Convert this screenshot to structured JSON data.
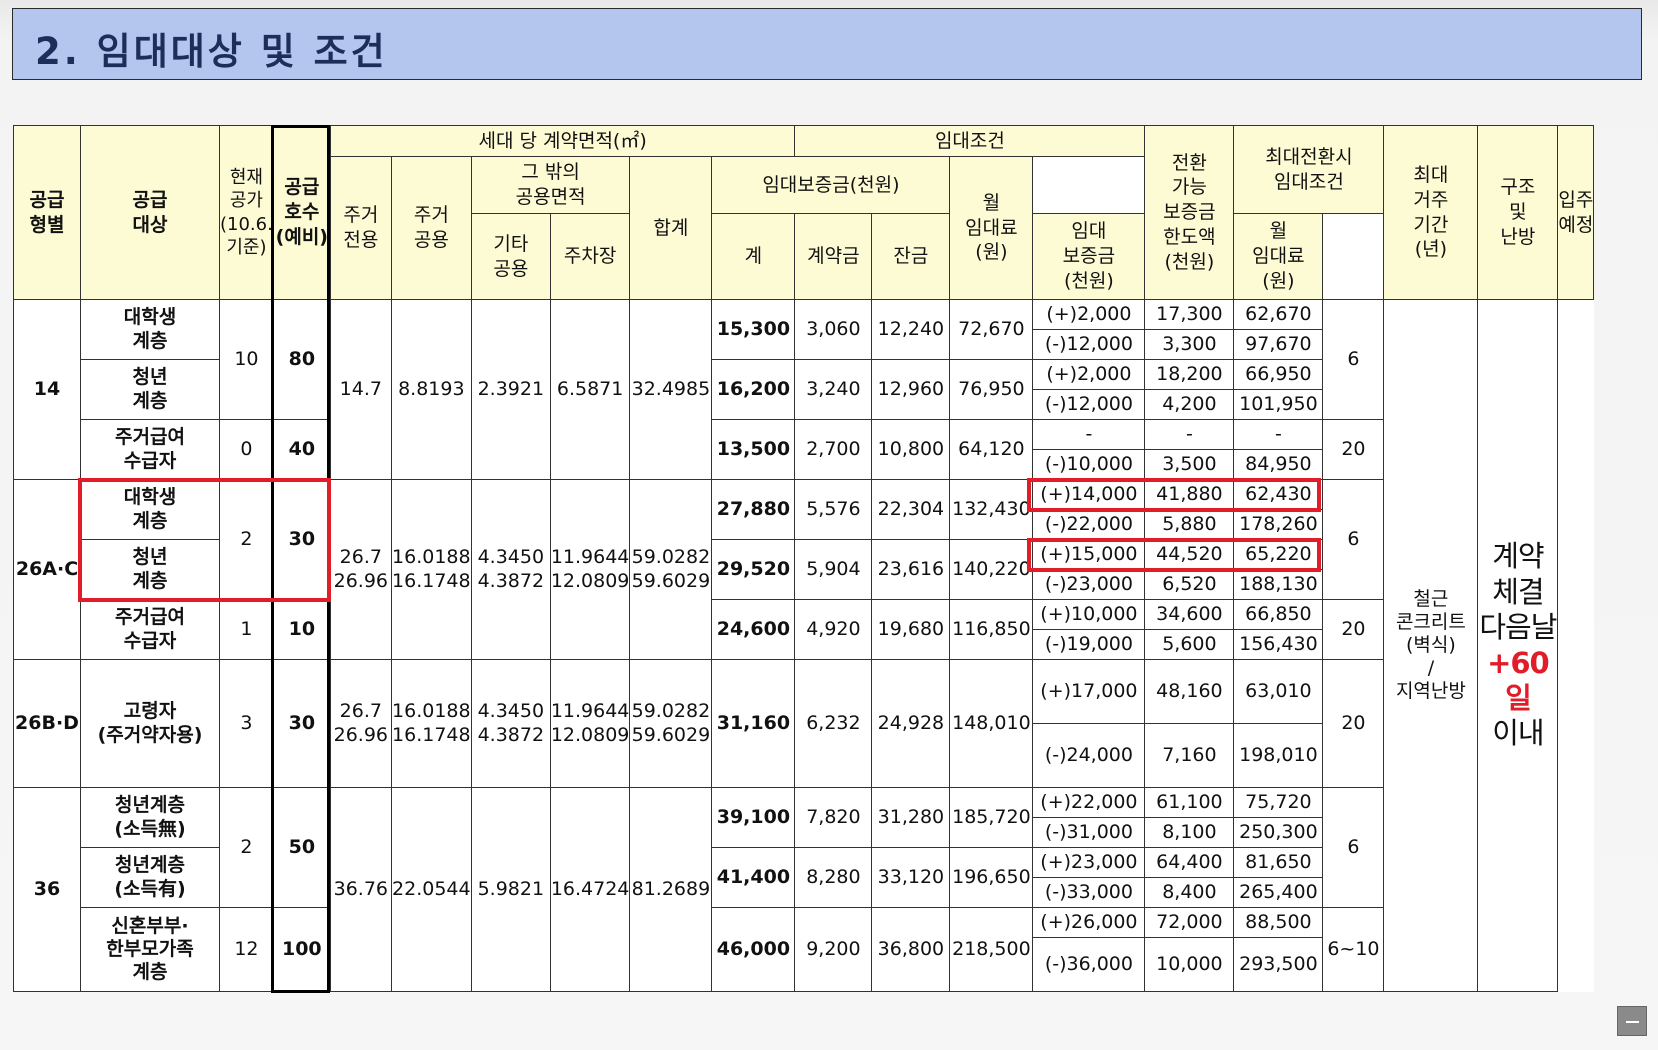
{
  "title": "2. 임대대상 및 조건",
  "header": {
    "supply_type": "공급\n형별",
    "supply_target": "공급\n대상",
    "vacancy": "현재\n공가\n(10.6.\n기준)",
    "supply_units": "공급\n호수\n(예비)",
    "area_group": "세대 당 계약면적(㎡)",
    "private_use": "주거\n전용",
    "residential_common": "주거\n공용",
    "other_common_group": "그 밖의\n공용면적",
    "other_common": "기타\n공용",
    "parking": "주차장",
    "area_total": "합계",
    "rent_group": "임대조건",
    "deposit_group": "임대보증금(천원)",
    "deposit_total": "계",
    "deposit_contract": "계약금",
    "deposit_balance": "잔금",
    "monthly_rent": "월\n임대료\n(원)",
    "convertible_limit": "전환\n가능\n보증금\n한도액\n(천원)",
    "max_conversion_group": "최대전환시\n임대조건",
    "conv_deposit": "임대\n보증금\n(천원)",
    "conv_rent": "월\n임대료\n(원)",
    "max_residence": "최대\n거주\n기간\n(년)",
    "structure": "구조\n및\n난방",
    "move_in": "입주\n예정"
  },
  "rows": {
    "t14": {
      "type": "14",
      "area": {
        "private": "14.7",
        "common": "8.8193",
        "other": "2.3921",
        "parking": "6.5871",
        "total": "32.4985"
      },
      "targets": {
        "a": {
          "name": "대학생\n계층",
          "deposit": "15,300",
          "contract": "3,060",
          "balance": "12,240",
          "rent": "72,670",
          "conv": [
            {
              "limit": "(+)2,000",
              "deposit": "17,300",
              "rent": "62,670"
            },
            {
              "limit": "(-)12,000",
              "deposit": "3,300",
              "rent": "97,670"
            }
          ]
        },
        "b": {
          "name": "청년\n계층",
          "deposit": "16,200",
          "contract": "3,240",
          "balance": "12,960",
          "rent": "76,950",
          "conv": [
            {
              "limit": "(+)2,000",
              "deposit": "18,200",
              "rent": "66,950"
            },
            {
              "limit": "(-)12,000",
              "deposit": "4,200",
              "rent": "101,950"
            }
          ]
        },
        "c": {
          "name": "주거급여\n수급자",
          "deposit": "13,500",
          "contract": "2,700",
          "balance": "10,800",
          "rent": "64,120",
          "conv": [
            {
              "limit": "-",
              "deposit": "-",
              "rent": "-"
            },
            {
              "limit": "(-)10,000",
              "deposit": "3,500",
              "rent": "84,950"
            }
          ]
        }
      },
      "vacancy_ab": "10",
      "units_ab": "80",
      "vacancy_c": "0",
      "units_c": "40",
      "period_ab": "6",
      "period_c": "20"
    },
    "t26ac": {
      "type": "26A·C",
      "area": {
        "private": "26.7\n26.96",
        "common": "16.0188\n16.1748",
        "other": "4.3450\n4.3872",
        "parking": "11.9644\n12.0809",
        "total": "59.0282\n59.6029"
      },
      "targets": {
        "a": {
          "name": "대학생\n계층",
          "deposit": "27,880",
          "contract": "5,576",
          "balance": "22,304",
          "rent": "132,430",
          "conv": [
            {
              "limit": "(+)14,000",
              "deposit": "41,880",
              "rent": "62,430"
            },
            {
              "limit": "(-)22,000",
              "deposit": "5,880",
              "rent": "178,260"
            }
          ]
        },
        "b": {
          "name": "청년\n계층",
          "deposit": "29,520",
          "contract": "5,904",
          "balance": "23,616",
          "rent": "140,220",
          "conv": [
            {
              "limit": "(+)15,000",
              "deposit": "44,520",
              "rent": "65,220"
            },
            {
              "limit": "(-)23,000",
              "deposit": "6,520",
              "rent": "188,130"
            }
          ]
        },
        "c": {
          "name": "주거급여\n수급자",
          "deposit": "24,600",
          "contract": "4,920",
          "balance": "19,680",
          "rent": "116,850",
          "conv": [
            {
              "limit": "(+)10,000",
              "deposit": "34,600",
              "rent": "66,850"
            },
            {
              "limit": "(-)19,000",
              "deposit": "5,600",
              "rent": "156,430"
            }
          ]
        }
      },
      "vacancy_ab": "2",
      "units_ab": "30",
      "vacancy_c": "1",
      "units_c": "10",
      "period_ab": "6",
      "period_c": "20"
    },
    "t26bd": {
      "type": "26B·D",
      "area": {
        "private": "26.7\n26.96",
        "common": "16.0188\n16.1748",
        "other": "4.3450\n4.3872",
        "parking": "11.9644\n12.0809",
        "total": "59.0282\n59.6029"
      },
      "target": {
        "name": "고령자\n(주거약자용)",
        "deposit": "31,160",
        "contract": "6,232",
        "balance": "24,928",
        "rent": "148,010",
        "conv": [
          {
            "limit": "(+)17,000",
            "deposit": "48,160",
            "rent": "63,010"
          },
          {
            "limit": "(-)24,000",
            "deposit": "7,160",
            "rent": "198,010"
          }
        ]
      },
      "vacancy": "3",
      "units": "30",
      "period": "20"
    },
    "t36": {
      "type": "36",
      "area": {
        "private": "36.76",
        "common": "22.0544",
        "other": "5.9821",
        "parking": "16.4724",
        "total": "81.2689"
      },
      "targets": {
        "a": {
          "name": "청년계층\n(소득無)",
          "deposit": "39,100",
          "contract": "7,820",
          "balance": "31,280",
          "rent": "185,720",
          "conv": [
            {
              "limit": "(+)22,000",
              "deposit": "61,100",
              "rent": "75,720"
            },
            {
              "limit": "(-)31,000",
              "deposit": "8,100",
              "rent": "250,300"
            }
          ]
        },
        "b": {
          "name": "청년계층\n(소득有)",
          "deposit": "41,400",
          "contract": "8,280",
          "balance": "33,120",
          "rent": "196,650",
          "conv": [
            {
              "limit": "(+)23,000",
              "deposit": "64,400",
              "rent": "81,650"
            },
            {
              "limit": "(-)33,000",
              "deposit": "8,400",
              "rent": "265,400"
            }
          ]
        },
        "c": {
          "name": "신혼부부·\n한부모가족\n계층",
          "deposit": "46,000",
          "contract": "9,200",
          "balance": "36,800",
          "rent": "218,500",
          "conv": [
            {
              "limit": "(+)26,000",
              "deposit": "72,000",
              "rent": "88,500"
            },
            {
              "limit": "(-)36,000",
              "deposit": "10,000",
              "rent": "293,500"
            }
          ]
        }
      },
      "vacancy_ab": "2",
      "units_ab": "50",
      "vacancy_c": "12",
      "units_c": "100",
      "period_ab": "6",
      "period_c": "6~10"
    }
  },
  "structure": "철근\n콘크리트\n(벽식)\n/\n지역난방",
  "move_in": {
    "line1": "계약",
    "line2": "체결",
    "line3": "다음날",
    "highlight": "+60일",
    "line4": "이내"
  },
  "colors": {
    "header_bg": "#fdfbd4",
    "title_bg": "#b4c6ee",
    "highlight": "#e21d2a"
  }
}
